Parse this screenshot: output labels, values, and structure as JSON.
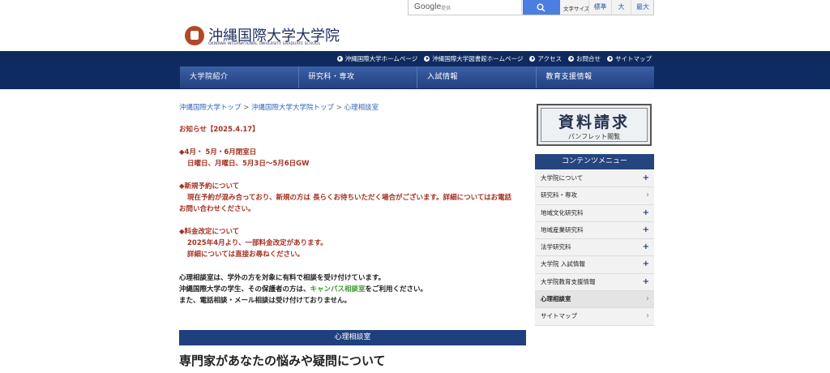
{
  "search": {
    "brand": "Google",
    "provider": "提供"
  },
  "font_size": {
    "label": "文字サイズ",
    "options": [
      "標準",
      "大",
      "最大"
    ]
  },
  "logo": {
    "title": "沖縄国際大学大学院",
    "subtitle": "OKINAWA INTERNATIONAL UNIVERSITY GRADUATE SCHOOL"
  },
  "utility_nav": [
    "沖縄国際大学ホームページ",
    "沖縄国際大学図書館ホームページ",
    "アクセス",
    "お問合せ",
    "サイトマップ"
  ],
  "main_nav": [
    "大学院紹介",
    "研究科・専攻",
    "入試情報",
    "教育支援情報"
  ],
  "breadcrumb": {
    "items": [
      "沖縄国際大学トップ",
      "沖縄国際大学大学院トップ",
      "心理相談室"
    ],
    "separator": ">"
  },
  "notice": {
    "date": "お知らせ【2025.4.17】",
    "closed_title": "◆4月・ 5月・6月閉室日",
    "closed_body": "日曜日、月曜日、5月3日〜5月6日GW",
    "reservation_title": "◆新規予約について",
    "reservation_line1": "現在予約が混み合っており、新規の方は 長らくお待ちいただく場合がございます。詳細についてはお電話",
    "reservation_line2": "お問い合わせください。",
    "fee_title": "◆料金改定について",
    "fee_line1": "2025年4月より、一部料金改定があります。",
    "fee_line2": "詳細については直接お尋ねください。"
  },
  "about": {
    "line1": "心理相談室は、学外の方を対象に有料で相談を受け付けています。",
    "line2_pre": "沖縄国際大学の学生、その保護者の方は、",
    "line2_link": "キャンパス相談室",
    "line2_post": "をご利用ください。",
    "line3": "また、電話相談・メール相談は受け付けておりません。"
  },
  "section_bar": "心理相談室",
  "heading": "専門家があなたの悩みや疑問について",
  "sidebar": {
    "banner_title": "資料請求",
    "banner_sub": "パンフレット閲覧",
    "menu_title": "コンテンツメニュー",
    "items": [
      {
        "label": "大学院について",
        "mark": "+"
      },
      {
        "label": "研究科・専攻",
        "mark": "›"
      },
      {
        "label": "地域文化研究科",
        "mark": "+"
      },
      {
        "label": "地域産業研究科",
        "mark": "+"
      },
      {
        "label": "法学研究科",
        "mark": "+"
      },
      {
        "label": "大学院 入試情報",
        "mark": "+"
      },
      {
        "label": "大学院教育支援情報",
        "mark": "+"
      },
      {
        "label": "心理相談室",
        "mark": "›"
      },
      {
        "label": "サイトマップ",
        "mark": "›"
      }
    ]
  },
  "colors": {
    "navy": "#0e2a5f",
    "nav_blue": "#2c4f93",
    "red_text": "#a4301f",
    "link_blue": "#3565b8",
    "link_green": "#3f9a33"
  }
}
